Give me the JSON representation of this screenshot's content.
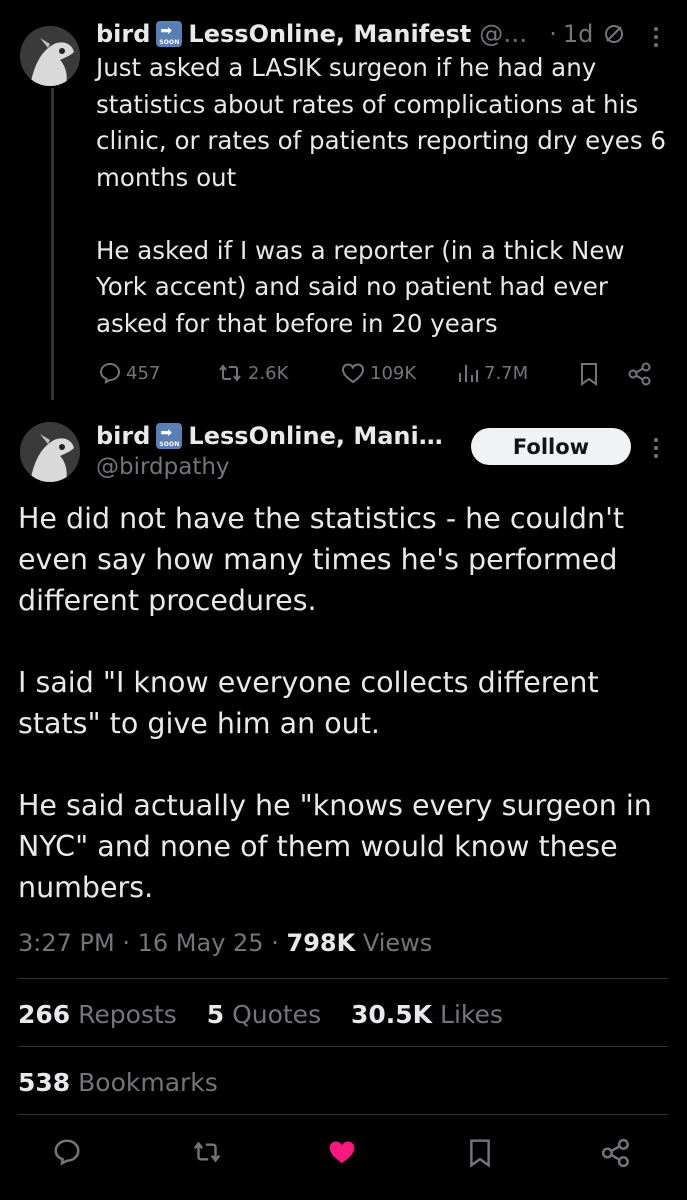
{
  "tweet1": {
    "display_name": "bird",
    "badge_label": "SOON",
    "display_name_suffix": "LessOnline, Manifest",
    "handle": "@…",
    "separator": "·",
    "time_ago": "1d",
    "text": "Just asked a LASIK surgeon if he had any statistics about rates of complications at his clinic, or rates of patients reporting dry eyes 6 months out\n\nHe asked if I was a reporter (in a thick New York accent) and said no patient had ever asked for that before in 20 years",
    "actions": {
      "replies": "457",
      "reposts": "2.6K",
      "likes": "109K",
      "views": "7.7M"
    }
  },
  "tweet2": {
    "display_name": "bird",
    "badge_label": "SOON",
    "display_name_suffix": "LessOnline, Mani…",
    "handle": "@birdpathy",
    "follow_label": "Follow",
    "text": "He did not have the statistics - he couldn't even say how many times he's performed different procedures.\n\nI said \"I know everyone collects different stats\" to give him an out.\n\nHe said actually he \"knows every surgeon in NYC\" and none of them would know these numbers.",
    "time": "3:27 PM",
    "date": "16 May 25",
    "views_count": "798K",
    "views_label": "Views",
    "dot": "·",
    "reposts_count": "266",
    "reposts_label": "Reposts",
    "quotes_count": "5",
    "quotes_label": "Quotes",
    "likes_count": "30.5K",
    "likes_label": "Likes",
    "bookmarks_count": "538",
    "bookmarks_label": "Bookmarks"
  },
  "colors": {
    "background": "#000000",
    "text": "#e7e9ea",
    "muted": "#71767b",
    "like_active": "#f91880",
    "follow_bg": "#eff3f4"
  },
  "icons": [
    "reply-icon",
    "repost-icon",
    "like-icon",
    "views-icon",
    "bookmark-icon",
    "share-icon",
    "more-icon",
    "soon-arrow-icon",
    "no-reply-icon"
  ]
}
